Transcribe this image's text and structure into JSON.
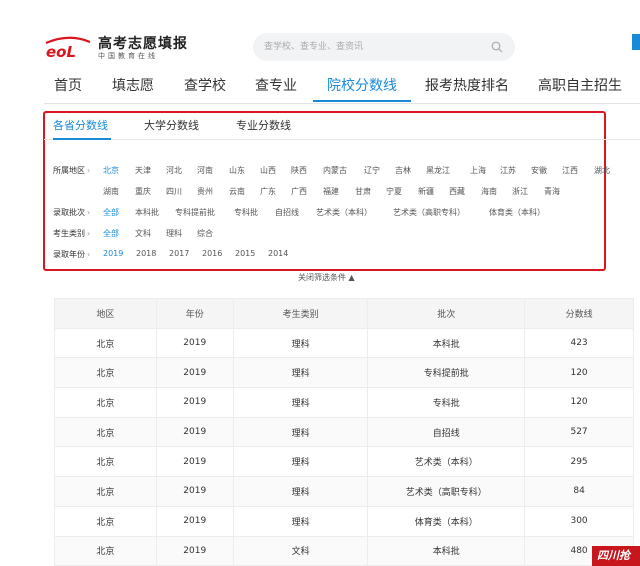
{
  "brand": {
    "title": "高考志愿填报",
    "subtitle": "中国教育在线"
  },
  "search": {
    "placeholder": "查学校、查专业、查资讯"
  },
  "nav": {
    "items": [
      {
        "label": "首页"
      },
      {
        "label": "填志愿"
      },
      {
        "label": "查学校"
      },
      {
        "label": "查专业"
      },
      {
        "label": "院校分数线",
        "active": true
      },
      {
        "label": "报考热度排名"
      },
      {
        "label": "高职自主招生"
      }
    ]
  },
  "subtabs": [
    {
      "label": "各省分数线",
      "active": true
    },
    {
      "label": "大学分数线"
    },
    {
      "label": "专业分数线"
    }
  ],
  "filters": {
    "region": {
      "label": "所属地区",
      "options": [
        "北京",
        "天津",
        "河北",
        "河南",
        "山东",
        "山西",
        "陕西",
        "内蒙古",
        "辽宁",
        "吉林",
        "黑龙江",
        "上海",
        "江苏",
        "安徽",
        "江西",
        "湖北",
        "湖南",
        "重庆",
        "四川",
        "贵州",
        "云南",
        "广东",
        "广西",
        "福建",
        "甘肃",
        "宁夏",
        "新疆",
        "西藏",
        "海南",
        "浙江",
        "青海"
      ],
      "selected": "北京"
    },
    "batch": {
      "label": "录取批次",
      "options": [
        "全部",
        "本科批",
        "专科提前批",
        "专科批",
        "自招线",
        "艺术类（本科）",
        "艺术类（高职专科）",
        "体育类（本科）"
      ],
      "selected": "全部"
    },
    "category": {
      "label": "考生类别",
      "options": [
        "全部",
        "文科",
        "理科",
        "综合"
      ],
      "selected": "全部"
    },
    "year": {
      "label": "录取年份",
      "options": [
        "2019",
        "2018",
        "2017",
        "2016",
        "2015",
        "2014"
      ],
      "selected": "2019"
    },
    "collapse_label": "关闭筛选条件"
  },
  "table": {
    "headers": [
      "地区",
      "年份",
      "考生类别",
      "批次",
      "分数线"
    ],
    "rows": [
      [
        "北京",
        "2019",
        "理科",
        "本科批",
        "423"
      ],
      [
        "北京",
        "2019",
        "理科",
        "专科提前批",
        "120"
      ],
      [
        "北京",
        "2019",
        "理科",
        "专科批",
        "120"
      ],
      [
        "北京",
        "2019",
        "理科",
        "自招线",
        "527"
      ],
      [
        "北京",
        "2019",
        "理科",
        "艺术类（本科）",
        "295"
      ],
      [
        "北京",
        "2019",
        "理科",
        "艺术类（高职专科）",
        "84"
      ],
      [
        "北京",
        "2019",
        "理科",
        "体育类（本科）",
        "300"
      ],
      [
        "北京",
        "2019",
        "文科",
        "本科批",
        "480"
      ]
    ]
  },
  "stamp": {
    "text": "四川抢"
  },
  "colors": {
    "accent": "#1a8ad7",
    "highlight_border": "#d9151f"
  }
}
